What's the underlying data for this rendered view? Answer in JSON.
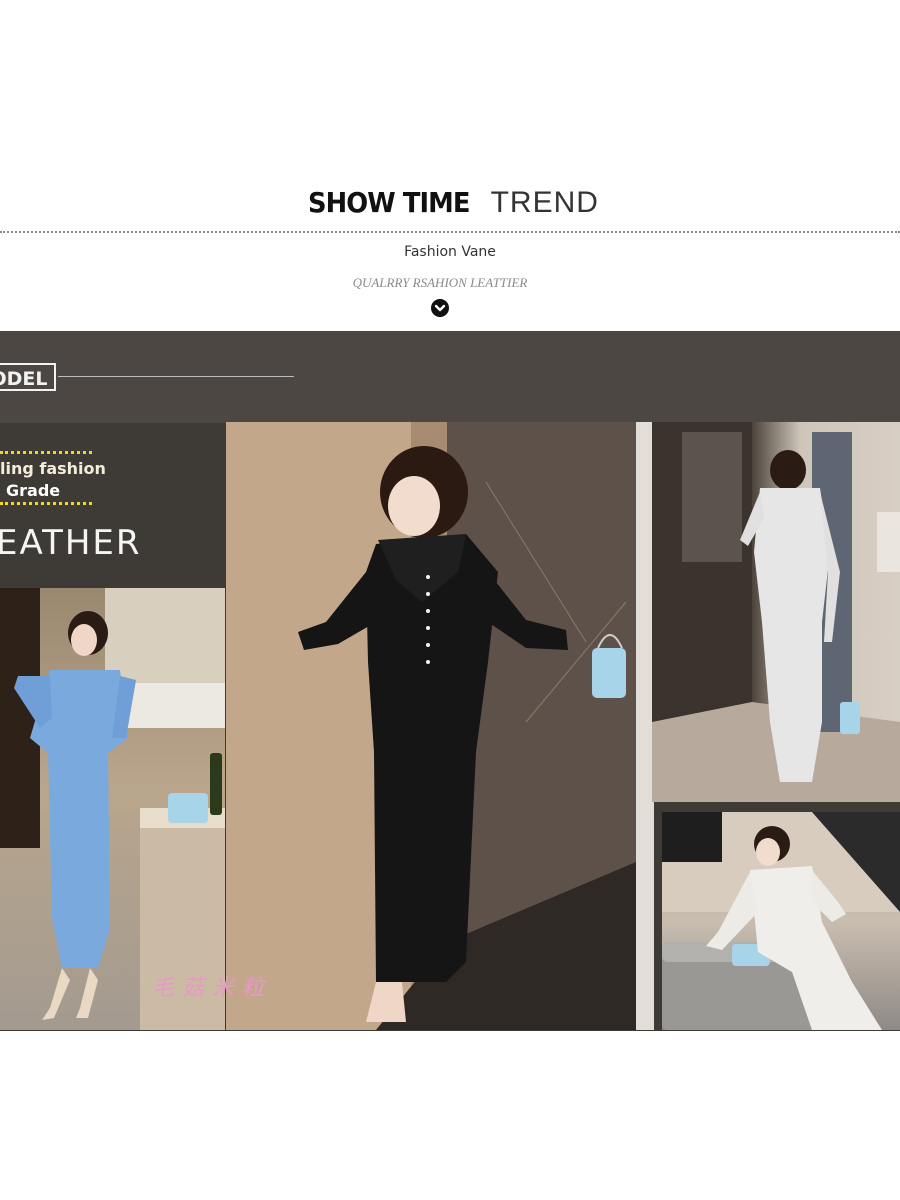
{
  "header": {
    "title_bold": "SHOW TIME",
    "title_light": "TREND",
    "subtitle": "Fashion Vane",
    "tagline": "QUALRRY RSAHION LEATTIER",
    "scroll_icon": "chevron-down-circle-icon"
  },
  "banner": {
    "model_label": "ODEL",
    "fashion_line": "ling fashion",
    "grade_line": "Grade",
    "leather_word": "EATHER",
    "accent_color": "#f2da1a",
    "background_color": "#4c4743"
  },
  "photos": [
    {
      "name": "blue-dress-photo",
      "dress_color": "#7aa9dd"
    },
    {
      "name": "black-dress-photo",
      "dress_color": "#151515"
    },
    {
      "name": "white-dress-back-photo",
      "dress_color": "#e6e6e6"
    },
    {
      "name": "white-dress-seated-photo",
      "dress_color": "#f0eeea"
    }
  ],
  "watermark": "毛菇米粒"
}
